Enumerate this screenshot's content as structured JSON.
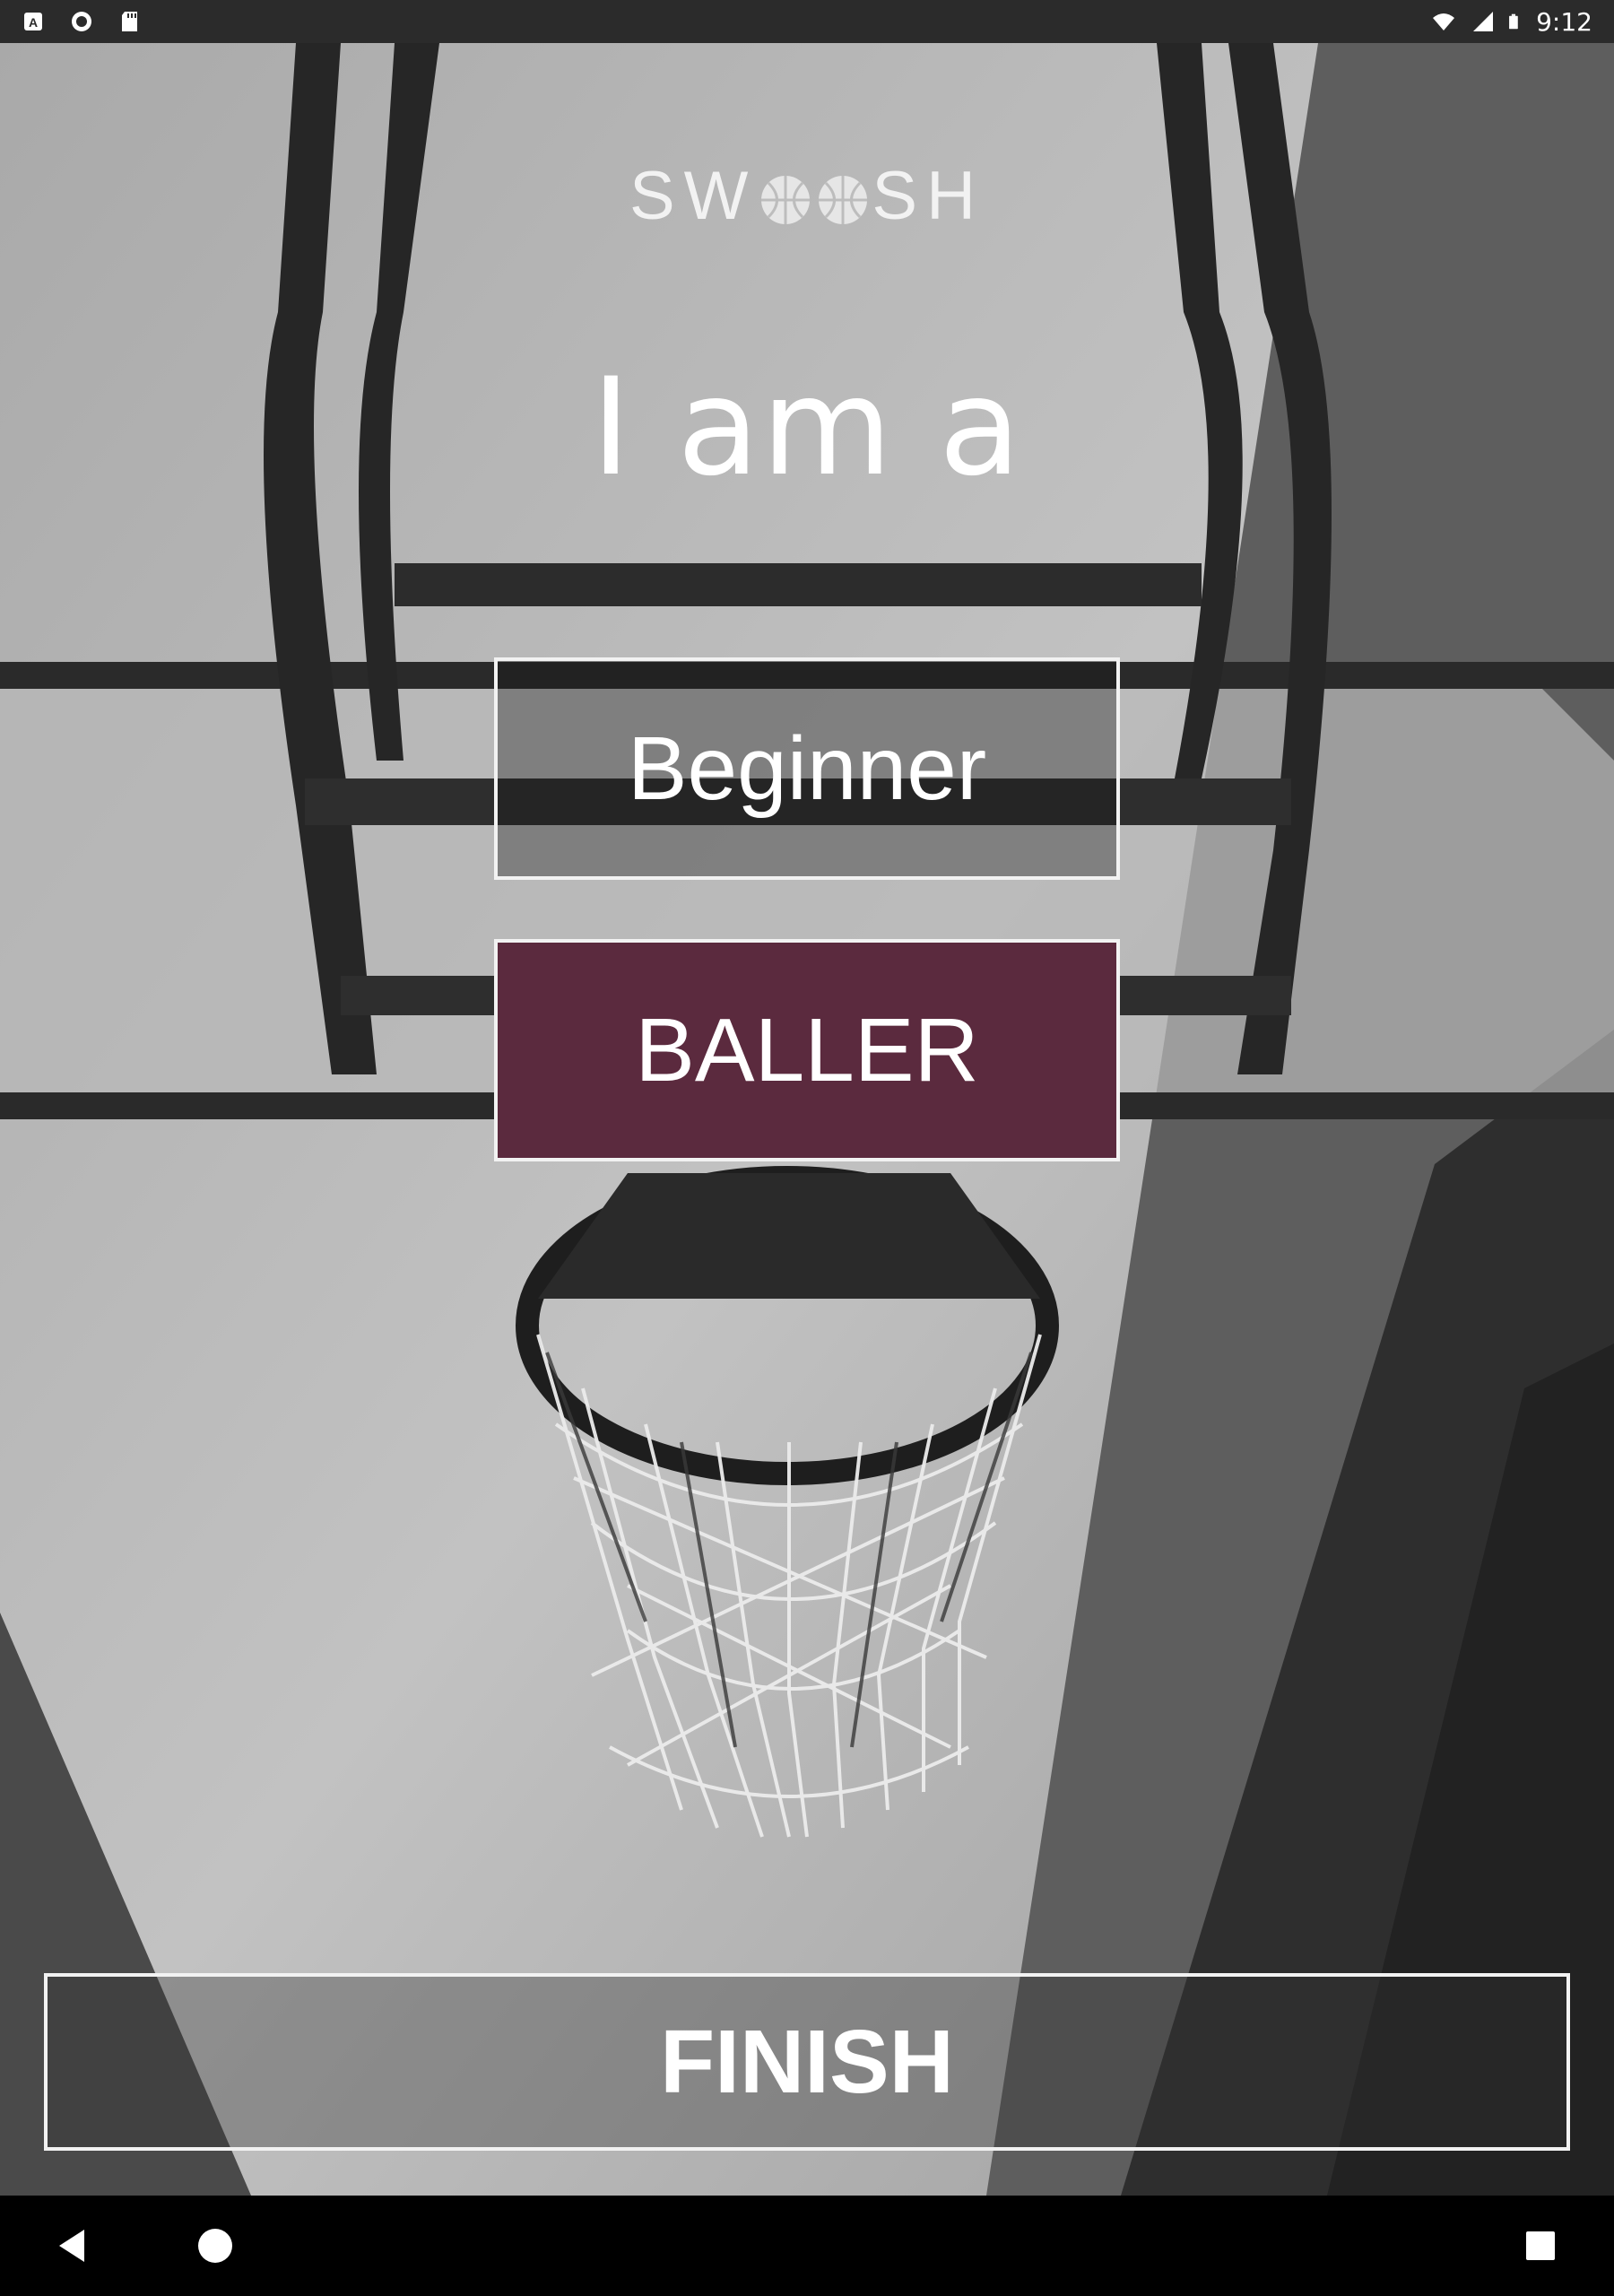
{
  "status_bar": {
    "time": "9:12",
    "left_icons": [
      "a-icon",
      "circle-icon",
      "sd-card-icon"
    ],
    "right_icons": [
      "wifi-icon",
      "signal-icon",
      "battery-icon"
    ]
  },
  "logo": {
    "text_before": "SW",
    "text_after": "SH"
  },
  "heading": "I am a",
  "options": {
    "beginner_label": "Beginner",
    "baller_label": "BALLER",
    "selected": "BALLER"
  },
  "finish_label": "FINISH",
  "colors": {
    "selected_bg": "#5b2a3e",
    "border": "#f2f2f2",
    "text": "#ffffff"
  },
  "nav_bar": {
    "icons": [
      "back-icon",
      "home-icon",
      "recents-icon"
    ]
  }
}
